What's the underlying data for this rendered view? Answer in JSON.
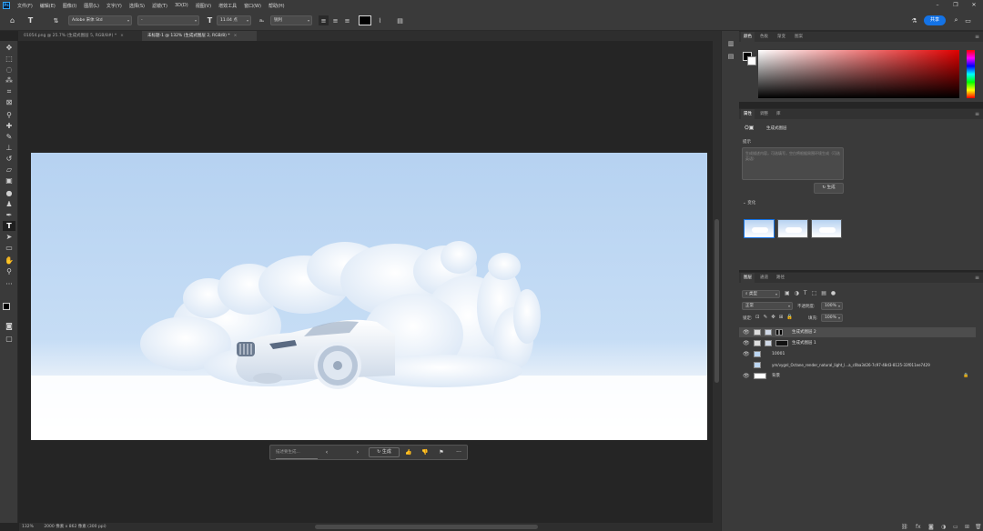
{
  "menubar": {
    "logo": "Ps",
    "items": [
      "文件(F)",
      "编辑(E)",
      "图像(I)",
      "图层(L)",
      "文字(Y)",
      "选择(S)",
      "滤镜(T)",
      "3D(D)",
      "视图(V)",
      "增效工具",
      "窗口(W)",
      "帮助(H)"
    ]
  },
  "window_controls": [
    "–",
    "❐",
    "✕"
  ],
  "options": {
    "font_family": "Adobe 宋体 Std",
    "font_style": "-",
    "font_size": "11.04 点",
    "antialias": "锐利",
    "share_label": "共享",
    "text_color": "#000000"
  },
  "tabs": [
    {
      "label": "01054.png @ 25.7% (生成式图层 5, RGB/8#) *",
      "close": "×"
    },
    {
      "label": "未标题-1 @ 132% (生成式图层 2, RGB/8) *",
      "close": "×"
    }
  ],
  "generate_bar": {
    "placeholder": "描述要生成...",
    "prev": "‹",
    "next": "›",
    "generate_label": "生成",
    "more": "···"
  },
  "status": {
    "zoom": "132%",
    "doc_size": "2000 像素 x 862 像素 (300 ppi)"
  },
  "color_panel": {
    "tabs": [
      "颜色",
      "色板",
      "渐变",
      "图案"
    ]
  },
  "properties_panel": {
    "tabs": [
      "属性",
      "调整",
      "库"
    ],
    "layer_type": "生成式图层",
    "prompt_label": "提示",
    "prompt_placeholder": "生成描述内容，可选填写，空白将根据周围环境生成（可选英语）",
    "generate_label": "生成",
    "variations_label": "变化"
  },
  "layers_panel": {
    "tabs": [
      "图层",
      "通道",
      "路径"
    ],
    "kind_label": "类型",
    "blend_mode": "正常",
    "opacity_label": "不透明度:",
    "opacity_value": "100%",
    "lock_label": "锁定:",
    "fill_label": "填充:",
    "fill_value": "100%",
    "layers": [
      {
        "name": "生成式图层 2",
        "selected": true
      },
      {
        "name": "生成式图层 1",
        "selected": false
      },
      {
        "name": "10001",
        "selected": false
      },
      {
        "name": "ym/vygnl_Octane_render_natural_light_l...a_c0ba3d26-7c97-48d3-8125-33f011ee7429",
        "selected": false
      },
      {
        "name": "背景",
        "selected": false
      }
    ]
  },
  "colors": {
    "accent": "#1473e6",
    "sky": "#bcd6f2"
  }
}
